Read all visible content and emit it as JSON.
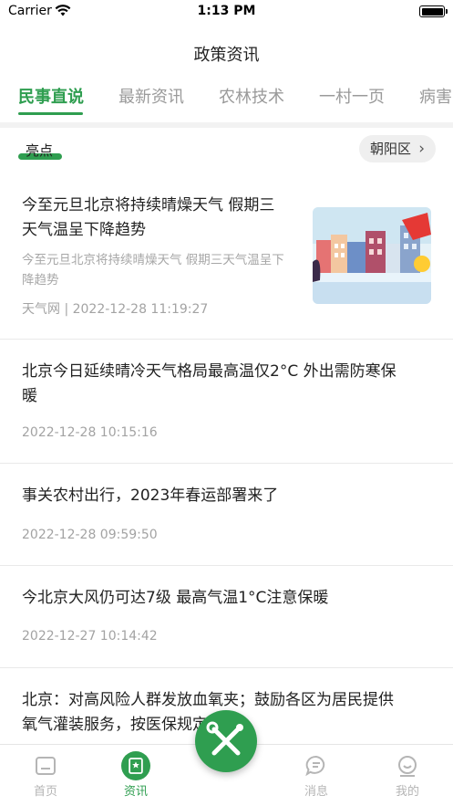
{
  "status_bar": {
    "carrier": "Carrier",
    "time": "1:13 PM"
  },
  "header": {
    "title": "政策资讯"
  },
  "tabs": [
    {
      "label": "民事直说",
      "active": true
    },
    {
      "label": "最新资讯",
      "active": false
    },
    {
      "label": "农林技术",
      "active": false
    },
    {
      "label": "一村一页",
      "active": false
    },
    {
      "label": "病害",
      "active": false
    }
  ],
  "highlight": {
    "label": "亮点",
    "district": "朝阳区"
  },
  "news": [
    {
      "title_line1": "今至元旦北京将持续晴燥天气 假期三",
      "title_line2": "天气温呈下降趋势",
      "summary_line1": "今至元旦北京将持续晴燥天气 假期三天气温呈下",
      "summary_line2": "降趋势",
      "meta": "天气网 | 2022-12-28 11:19:27",
      "has_image": true
    },
    {
      "title_line1": "北京今日延续晴冷天气格局最高温仅2°C 外出需防寒保",
      "title_line2": "暖",
      "meta": "2022-12-28 10:15:16"
    },
    {
      "title_line1": "事关农村出行，2023年春运部署来了",
      "meta": "2022-12-28 09:59:50"
    },
    {
      "title_line1": "今北京大风仍可达7级 最高气温1°C注意保暖",
      "meta": "2022-12-27 10:14:42"
    },
    {
      "title_line1": "北京：对高风险人群发放血氧夹；鼓励各区为居民提供",
      "title_line2": "氧气灌装服务，按医保规定报销"
    }
  ],
  "tabbar": [
    {
      "label": "首页",
      "icon": "home-icon"
    },
    {
      "label": "资讯",
      "icon": "news-icon",
      "active": true
    },
    {
      "label": "消息",
      "icon": "message-icon"
    },
    {
      "label": "我的",
      "icon": "profile-icon"
    }
  ],
  "fab": {
    "icon": "tools-icon"
  },
  "colors": {
    "accent": "#2f9e50",
    "muted": "#a3a3a3"
  }
}
